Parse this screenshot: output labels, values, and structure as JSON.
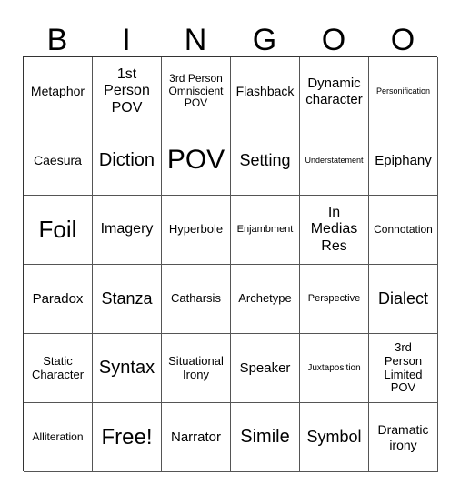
{
  "header": {
    "letters": [
      "B",
      "I",
      "N",
      "G",
      "O",
      "O"
    ]
  },
  "cells": [
    [
      "Metaphor",
      "1st Person POV",
      "3rd Person Omniscient POV",
      "Flashback",
      "Dynamic character",
      "Personification"
    ],
    [
      "Caesura",
      "Diction",
      "POV",
      "Setting",
      "Understatement",
      "Epiphany"
    ],
    [
      "Foil",
      "Imagery",
      "Hyperbole",
      "Enjambment",
      "In Medias Res",
      "Connotation"
    ],
    [
      "Paradox",
      "Stanza",
      "Catharsis",
      "Archetype",
      "Perspective",
      "Dialect"
    ],
    [
      "Static Character",
      "Syntax",
      "Situational Irony",
      "Speaker",
      "Juxtaposition",
      "3rd Person Limited POV"
    ],
    [
      "Alliteration",
      "Free!",
      "Narrator",
      "Simile",
      "Symbol",
      "Dramatic irony"
    ]
  ]
}
